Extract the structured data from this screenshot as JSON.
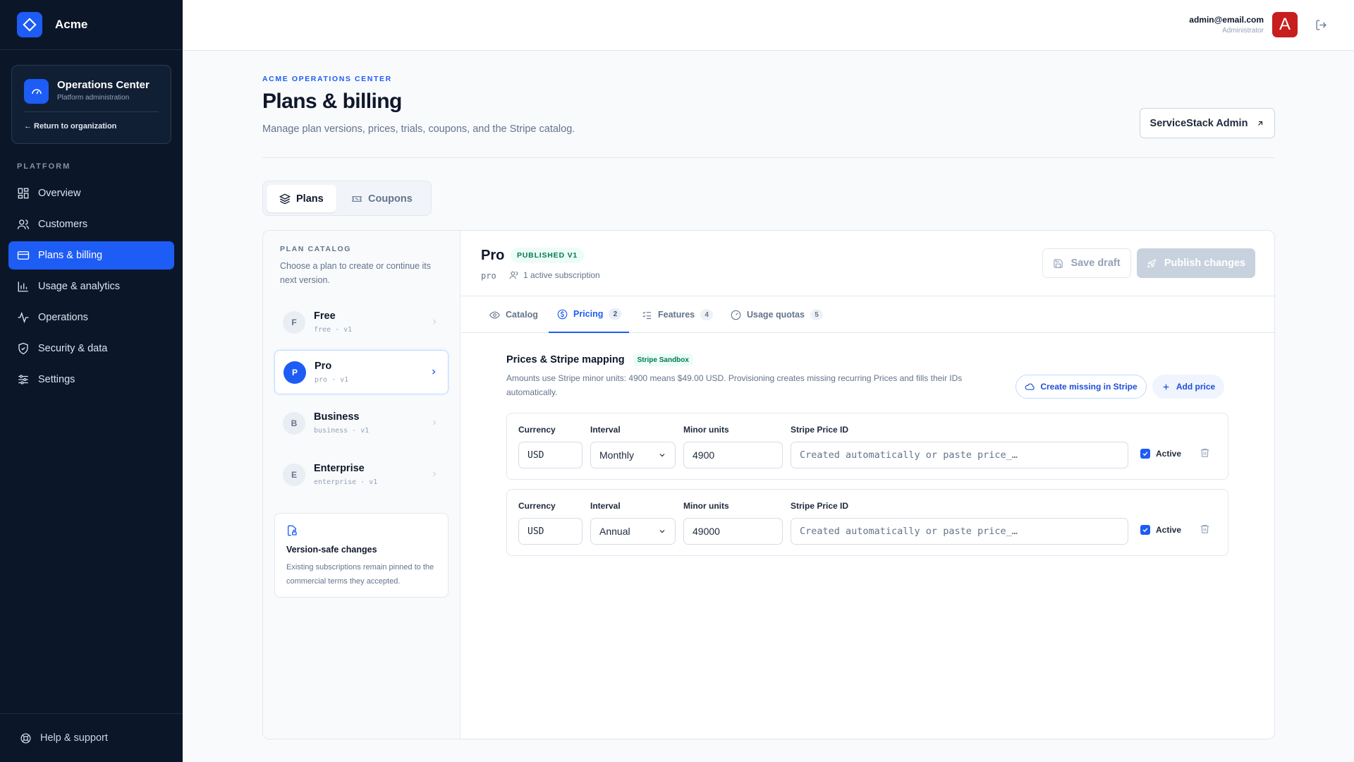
{
  "sidebar": {
    "brand": "Acme",
    "ops_card": {
      "title": "Operations Center",
      "subtitle": "Platform administration",
      "return_link": "← Return to organization"
    },
    "section_label": "PLATFORM",
    "items": [
      {
        "label": "Overview",
        "icon": "grid-icon"
      },
      {
        "label": "Customers",
        "icon": "users-icon"
      },
      {
        "label": "Plans & billing",
        "icon": "credit-card-icon",
        "active": true
      },
      {
        "label": "Usage & analytics",
        "icon": "bar-chart-icon"
      },
      {
        "label": "Operations",
        "icon": "activity-icon"
      },
      {
        "label": "Security & data",
        "icon": "shield-icon"
      },
      {
        "label": "Settings",
        "icon": "sliders-icon"
      }
    ],
    "help": "Help & support"
  },
  "topbar": {
    "email": "admin@email.com",
    "role": "Administrator",
    "avatar_letter": "A"
  },
  "header": {
    "eyebrow": "ACME OPERATIONS CENTER",
    "title": "Plans & billing",
    "subtitle": "Manage plan versions, prices, trials, coupons, and the Stripe catalog.",
    "admin_button": "ServiceStack Admin"
  },
  "tabs": [
    {
      "label": "Plans",
      "active": true
    },
    {
      "label": "Coupons",
      "active": false
    }
  ],
  "catalog": {
    "label": "PLAN CATALOG",
    "description": "Choose a plan to create or continue its next version.",
    "plans": [
      {
        "letter": "F",
        "name": "Free",
        "slug": "free · v1"
      },
      {
        "letter": "P",
        "name": "Pro",
        "slug": "pro · v1",
        "active": true
      },
      {
        "letter": "B",
        "name": "Business",
        "slug": "business · v1"
      },
      {
        "letter": "E",
        "name": "Enterprise",
        "slug": "enterprise · v1"
      }
    ],
    "version_card": {
      "title": "Version-safe changes",
      "description": "Existing subscriptions remain pinned to the commercial terms they accepted."
    }
  },
  "plan": {
    "name": "Pro",
    "badge": "PUBLISHED V1",
    "slug": "pro",
    "subscriptions": "1 active subscription",
    "save_draft": "Save draft",
    "publish": "Publish changes"
  },
  "subtabs": [
    {
      "label": "Catalog",
      "count": null
    },
    {
      "label": "Pricing",
      "count": "2",
      "active": true
    },
    {
      "label": "Features",
      "count": "4"
    },
    {
      "label": "Usage quotas",
      "count": "5"
    }
  ],
  "pricing": {
    "title": "Prices & Stripe mapping",
    "badge": "Stripe Sandbox",
    "description": "Amounts use Stripe minor units: 4900 means $49.00 USD. Provisioning creates missing recurring Prices and fills their IDs automatically.",
    "create_missing": "Create missing in Stripe",
    "add_price": "Add price",
    "labels": {
      "currency": "Currency",
      "interval": "Interval",
      "minor_units": "Minor units",
      "stripe_id": "Stripe Price ID",
      "active": "Active"
    },
    "rows": [
      {
        "currency": "USD",
        "interval": "Monthly",
        "minor_units": "4900",
        "stripe_id_placeholder": "Created automatically or paste price_…",
        "active": true
      },
      {
        "currency": "USD",
        "interval": "Annual",
        "minor_units": "49000",
        "stripe_id_placeholder": "Created automatically or paste price_…",
        "active": true
      }
    ]
  },
  "colors": {
    "accent": "#1d5cf5",
    "sidebar_bg": "#0b1629",
    "success": "#047857",
    "avatar": "#c81e1e"
  }
}
